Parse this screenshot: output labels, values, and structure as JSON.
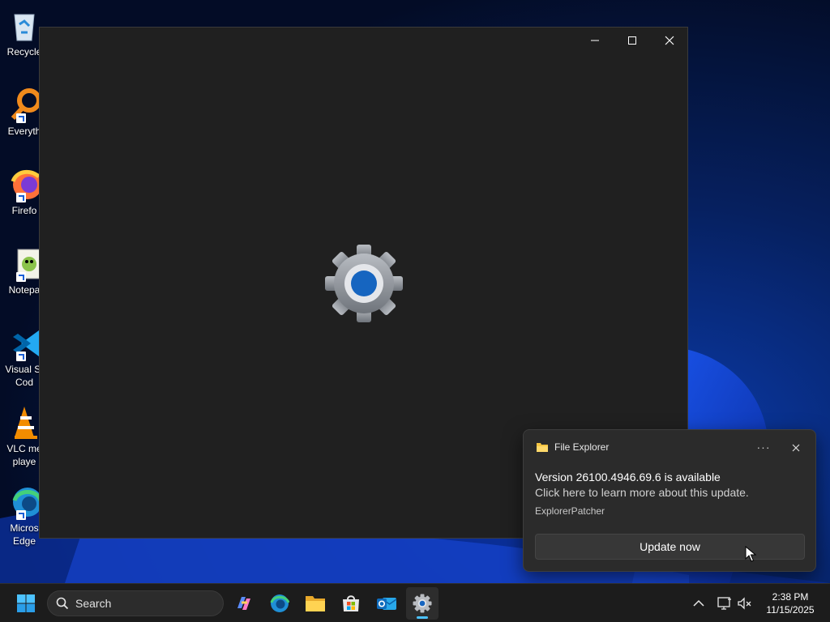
{
  "desktop": {
    "icons": [
      {
        "label": "Recycle",
        "icon": "recycle-bin-icon"
      },
      {
        "label": "Everyth",
        "icon": "everything-search-icon"
      },
      {
        "label": "Firefo",
        "icon": "firefox-icon"
      },
      {
        "label": "Notepa",
        "icon": "notepad-plus-plus-icon"
      },
      {
        "label": "Visual St\nCod",
        "icon": "vscode-icon"
      },
      {
        "label": "VLC me\nplaye",
        "icon": "vlc-icon"
      },
      {
        "label": "Micros\nEdge",
        "icon": "edge-icon"
      }
    ]
  },
  "window": {
    "minimize_glyph": "—",
    "maximize_glyph": "☐",
    "close_glyph": "✕",
    "content_icon": "settings-gear-icon"
  },
  "toast": {
    "app_name": "File Explorer",
    "more_glyph": "···",
    "title": "Version 26100.4946.69.6 is available",
    "body": "Click here to learn more about this update.",
    "attribution": "ExplorerPatcher",
    "button_label": "Update now"
  },
  "taskbar": {
    "search_placeholder": "Search",
    "apps": [
      "copilot-icon",
      "edge-icon",
      "file-explorer-icon",
      "microsoft-store-icon",
      "outlook-icon",
      "settings-icon"
    ],
    "active_app": "settings-icon",
    "time": "2:38 PM",
    "date": "11/15/2025"
  },
  "colors": {
    "accent": "#4cc2ff",
    "window_bg": "#202020",
    "toast_bg": "#2b2b2b",
    "taskbar_bg": "#1c1c1c"
  }
}
